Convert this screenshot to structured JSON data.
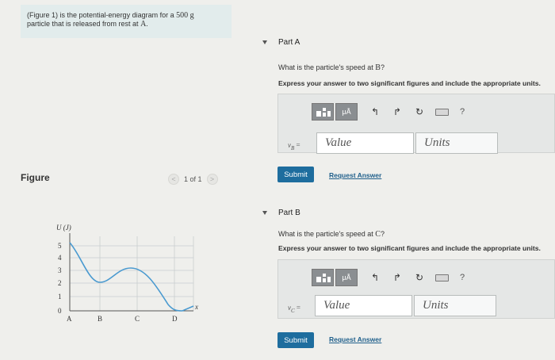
{
  "intro": {
    "text_pre": "(Figure 1) is the potential-energy diagram for a ",
    "mass": "500 g",
    "text_post": "particle that is released from rest at ",
    "point": "A",
    "period": "."
  },
  "figure": {
    "label": "Figure",
    "pager": {
      "prev": "<",
      "current": "1 of 1",
      "next": ">"
    },
    "graph": {
      "ylabel": "U (J)",
      "xlabel": "x",
      "y_ticks": [
        "5",
        "4",
        "3",
        "2",
        "1",
        "0"
      ],
      "x_labels": [
        "A",
        "B",
        "C",
        "D"
      ]
    }
  },
  "part_a": {
    "title": "Part A",
    "q_pre": "What is the particle's speed at ",
    "q_point": "B",
    "q_post": "?",
    "instruction": "Express your answer to two significant figures and include the appropriate units.",
    "toolbar": {
      "mu": "μÅ",
      "undo": "undo-icon",
      "redo": "redo-icon",
      "reset": "reset-icon",
      "keyboard": "keyboard-icon",
      "help": "?"
    },
    "var_name": "v",
    "var_sub": "B",
    "var_eq": " =",
    "value_placeholder": "Value",
    "units_placeholder": "Units",
    "submit": "Submit",
    "request": "Request Answer"
  },
  "part_b": {
    "title": "Part B",
    "q_pre": "What is the particle's speed at ",
    "q_point": "C",
    "q_post": "?",
    "instruction": "Express your answer to two significant figures and include the appropriate units.",
    "toolbar": {
      "mu": "μÅ",
      "undo": "undo-icon",
      "redo": "redo-icon",
      "reset": "reset-icon",
      "keyboard": "keyboard-icon",
      "help": "?"
    },
    "var_name": "v",
    "var_sub": "C",
    "var_eq": " =",
    "value_placeholder": "Value",
    "units_placeholder": "Units",
    "submit": "Submit",
    "request": "Request Answer"
  },
  "colors": {
    "submit": "#1e6d9e",
    "link": "#1f5f8b",
    "intro_bg": "#e2ecec",
    "curve": "#4a9ad0",
    "grid": "#c8cdd0"
  }
}
